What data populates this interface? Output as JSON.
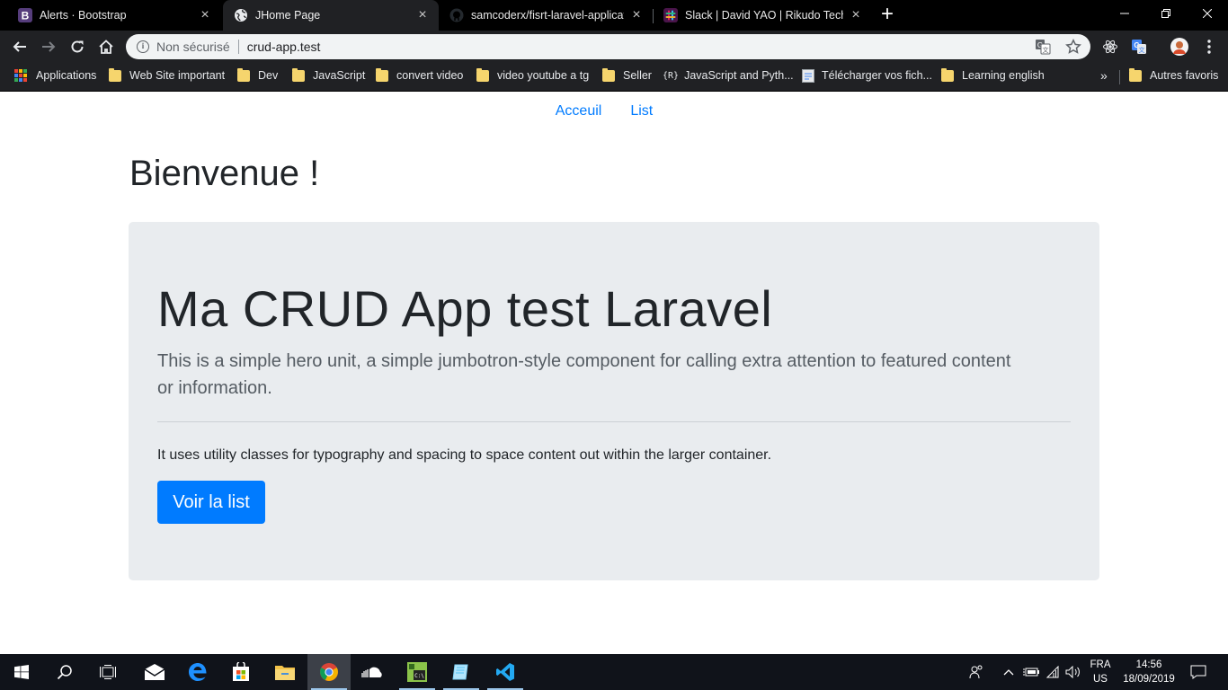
{
  "browser": {
    "tabs": [
      {
        "title": "Alerts · Bootstrap",
        "active": false
      },
      {
        "title": "JHome Page",
        "active": true
      },
      {
        "title": "samcoderx/fisrt-laravel-applicatio",
        "active": false
      },
      {
        "title": "Slack | David YAO | Rikudo Techno",
        "active": false
      }
    ],
    "address_bar": {
      "security_label": "Non sécurisé",
      "url": "crud-app.test"
    },
    "bookmarks": [
      {
        "label": "Applications",
        "icon": "apps-grid-icon"
      },
      {
        "label": "Web Site important",
        "icon": "folder-icon"
      },
      {
        "label": "Dev",
        "icon": "folder-icon"
      },
      {
        "label": "JavaScript",
        "icon": "folder-icon"
      },
      {
        "label": "convert video",
        "icon": "folder-icon"
      },
      {
        "label": "video youtube a tg",
        "icon": "folder-icon"
      },
      {
        "label": "Seller",
        "icon": "folder-icon"
      },
      {
        "label": "JavaScript and Pyth...",
        "icon": "code-braces-icon"
      },
      {
        "label": "Télécharger vos fich...",
        "icon": "file-icon"
      },
      {
        "label": "Learning english",
        "icon": "folder-icon"
      }
    ],
    "bookmarks_overflow": "»",
    "other_bookmarks": "Autres favoris"
  },
  "page": {
    "nav": {
      "home": "Acceuil",
      "list": "List"
    },
    "heading": "Bienvenue !",
    "jumbotron": {
      "title": "Ma CRUD App test Laravel",
      "lead": "This is a simple hero unit, a simple jumbotron-style component for calling extra attention to featured content or information.",
      "text": "It uses utility classes for typography and spacing to space content out within the larger container.",
      "button": "Voir la list"
    }
  },
  "taskbar": {
    "language": {
      "line1": "FRA",
      "line2": "US"
    },
    "time": "14:56",
    "date": "18/09/2019"
  },
  "colors": {
    "primary": "#007bff",
    "jumbotron_bg": "#e9ecef",
    "tab_strip": "#000000",
    "toolbar": "#202124",
    "taskbar": "#10131a"
  }
}
